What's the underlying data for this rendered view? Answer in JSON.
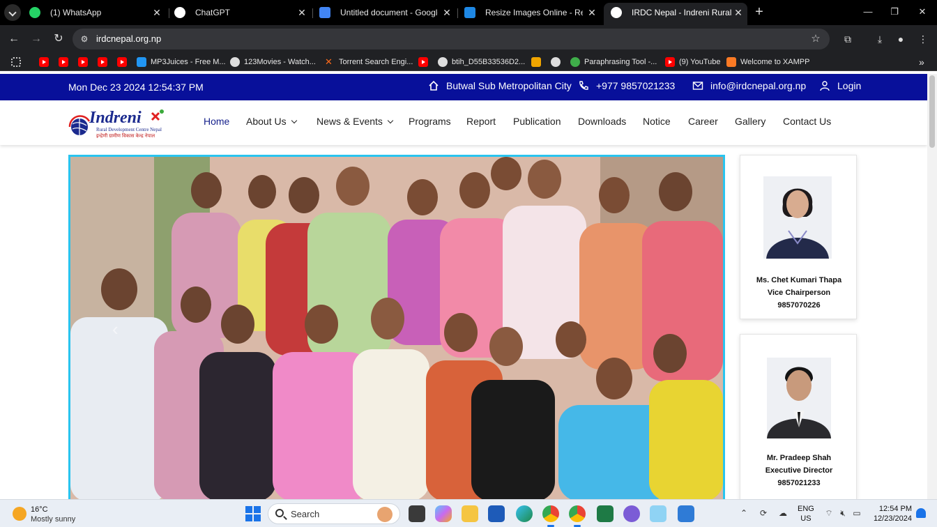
{
  "browser": {
    "tabs": [
      {
        "title": "(1) WhatsApp",
        "favicon": "whatsapp-icon",
        "color": "#25d366"
      },
      {
        "title": "ChatGPT",
        "favicon": "chatgpt-icon",
        "color": "#ffffff"
      },
      {
        "title": "Untitled document - Google Docs",
        "favicon": "google-docs-icon",
        "color": "#4285f4"
      },
      {
        "title": "Resize Images Online - Resize JPG",
        "favicon": "resize-image-icon",
        "color": "#1e88e5"
      },
      {
        "title": "IRDC Nepal - Indreni Rural Development",
        "favicon": "irdc-icon",
        "color": "#ffffff",
        "active": true
      }
    ],
    "url": "irdcnepal.org.np",
    "bookmarks": [
      {
        "label": "",
        "icon": "youtube-icon"
      },
      {
        "label": "",
        "icon": "youtube-icon"
      },
      {
        "label": "",
        "icon": "youtube-icon"
      },
      {
        "label": "",
        "icon": "youtube-icon"
      },
      {
        "label": "",
        "icon": "youtube-icon"
      },
      {
        "label": "MP3Juices - Free M...",
        "icon": "download-icon"
      },
      {
        "label": "123Movies - Watch...",
        "icon": "globe-icon"
      },
      {
        "label": "Torrent Search Engi...",
        "icon": "x-icon"
      },
      {
        "label": "",
        "icon": "youtube-icon"
      },
      {
        "label": "btih_D55B33536D2...",
        "icon": "globe-icon"
      },
      {
        "label": "",
        "icon": "hd-icon"
      },
      {
        "label": "",
        "icon": "globe-icon"
      },
      {
        "label": "Paraphrasing Tool -...",
        "icon": "paraphrase-icon"
      },
      {
        "label": "(9) YouTube",
        "icon": "youtube-icon"
      },
      {
        "label": "Welcome to XAMPP",
        "icon": "xampp-icon"
      }
    ]
  },
  "site": {
    "datetime": "Mon Dec 23 2024 12:54:37 PM",
    "location": "Butwal Sub Metropolitan City",
    "phone": "+977 9857021233",
    "email": "info@irdcnepal.org.np",
    "login": "Login",
    "logo_text": "Indreni",
    "logo_subtitle": "Rural Development Centre Nepal",
    "logo_subtitle_np": "इन्द्रेणी ग्रामीण विकास केन्द्र नेपाल",
    "menu": [
      {
        "label": "Home",
        "active": true
      },
      {
        "label": "About Us",
        "dropdown": true
      },
      {
        "label": "News & Events",
        "dropdown": true
      },
      {
        "label": "Programs"
      },
      {
        "label": "Report"
      },
      {
        "label": "Publication"
      },
      {
        "label": "Downloads"
      },
      {
        "label": "Notice"
      },
      {
        "label": "Career"
      },
      {
        "label": "Gallery"
      },
      {
        "label": "Contact Us"
      }
    ],
    "people": [
      {
        "name": "Ms. Chet Kumari Thapa",
        "role": "Vice Chairperson",
        "phone": "9857070226"
      },
      {
        "name": "Mr. Pradeep Shah",
        "role": "Executive Director",
        "phone": "9857021233"
      }
    ],
    "colors": {
      "topbar": "#08109a",
      "menu_active": "#16218c",
      "hero_border": "#29c4ef"
    }
  },
  "taskbar": {
    "temperature": "16°C",
    "weather": "Mostly sunny",
    "search": "Search",
    "lang_1": "ENG",
    "lang_2": "US",
    "time": "12:54 PM",
    "date": "12/23/2024"
  }
}
